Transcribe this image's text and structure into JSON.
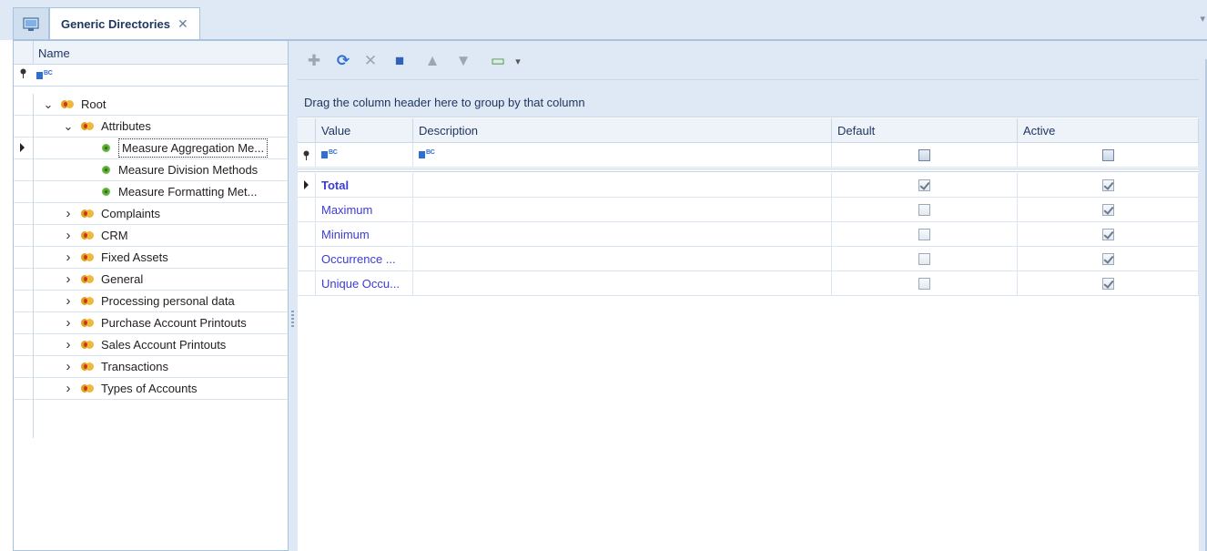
{
  "tabs": {
    "home_icon": "monitor-icon",
    "active_tab_label": "Generic Directories",
    "close_glyph": "✕",
    "overflow_glyph": "▾"
  },
  "tree": {
    "column_header": "Name",
    "filter_pin_glyph": "⚲",
    "filter_type_label": "BC",
    "nodes": [
      {
        "label": "Root",
        "level": 0,
        "expanded": true,
        "kind": "folder"
      },
      {
        "label": "Attributes",
        "level": 1,
        "expanded": true,
        "kind": "folder"
      },
      {
        "label": "Measure Aggregation Me...",
        "level": 2,
        "kind": "leaf",
        "selected": true
      },
      {
        "label": "Measure Division Methods",
        "level": 2,
        "kind": "leaf"
      },
      {
        "label": "Measure Formatting Met...",
        "level": 2,
        "kind": "leaf"
      },
      {
        "label": "Complaints",
        "level": 1,
        "expanded": false,
        "kind": "folder"
      },
      {
        "label": "CRM",
        "level": 1,
        "expanded": false,
        "kind": "folder"
      },
      {
        "label": "Fixed Assets",
        "level": 1,
        "expanded": false,
        "kind": "folder"
      },
      {
        "label": "General",
        "level": 1,
        "expanded": false,
        "kind": "folder"
      },
      {
        "label": "Processing personal data",
        "level": 1,
        "expanded": false,
        "kind": "folder"
      },
      {
        "label": "Purchase Account Printouts",
        "level": 1,
        "expanded": false,
        "kind": "folder"
      },
      {
        "label": "Sales Account Printouts",
        "level": 1,
        "expanded": false,
        "kind": "folder"
      },
      {
        "label": "Transactions",
        "level": 1,
        "expanded": false,
        "kind": "folder"
      },
      {
        "label": "Types of Accounts",
        "level": 1,
        "expanded": false,
        "kind": "folder"
      }
    ]
  },
  "toolbar": {
    "buttons": [
      {
        "name": "add-icon",
        "glyph": "✚",
        "color": "#9aa6b4"
      },
      {
        "name": "refresh-icon",
        "glyph": "⟳",
        "color": "#2f6fd0"
      },
      {
        "name": "delete-icon",
        "glyph": "✕",
        "color": "#9aa6b4"
      },
      {
        "name": "save-icon",
        "glyph": "■",
        "color": "#2f62b8"
      },
      {
        "name": "move-up-icon",
        "glyph": "▲",
        "color": "#9aa6b4"
      },
      {
        "name": "move-down-icon",
        "glyph": "▼",
        "color": "#9aa6b4"
      },
      {
        "name": "view-options-icon",
        "glyph": "▭",
        "color": "#4f9b3a"
      }
    ],
    "dropdown_glyph": "▾"
  },
  "grid": {
    "group_panel_text": "Drag the column header here to group by that column",
    "columns": {
      "value": "Value",
      "description": "Description",
      "default": "Default",
      "active": "Active"
    },
    "filter_type_label": "BC",
    "rows": [
      {
        "value": "Total",
        "description": "",
        "default": true,
        "active": true,
        "current": true
      },
      {
        "value": "Maximum",
        "description": "",
        "default": false,
        "active": true
      },
      {
        "value": "Minimum",
        "description": "",
        "default": false,
        "active": true
      },
      {
        "value": "Occurrence ...",
        "description": "",
        "default": false,
        "active": true
      },
      {
        "value": "Unique Occu...",
        "description": "",
        "default": false,
        "active": true
      }
    ]
  },
  "colors": {
    "chrome": "#dfe9f5",
    "border": "#a9c2de",
    "value_text": "#3b3bd6",
    "folder": "#e3a01c",
    "leaf": "#5aa832"
  }
}
